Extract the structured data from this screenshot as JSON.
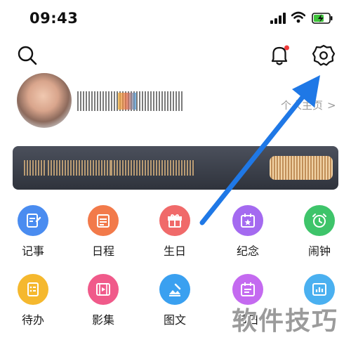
{
  "status_bar": {
    "time": "09:43",
    "icons": [
      "signal-icon",
      "wifi-icon",
      "battery-charging-icon"
    ]
  },
  "top_bar": {
    "icons": [
      "search-icon",
      "bell-icon",
      "gear-icon"
    ],
    "notification_dot_color": "#ef3b3b"
  },
  "profile": {
    "homepage_link": "个人主页",
    "chevron": ">"
  },
  "grid": {
    "items": [
      {
        "label": "记事",
        "icon": "note-icon",
        "color": "#4a8cf0"
      },
      {
        "label": "日程",
        "icon": "schedule-icon",
        "color": "#f27a4a"
      },
      {
        "label": "生日",
        "icon": "gift-icon",
        "color": "#f06a6a"
      },
      {
        "label": "纪念",
        "icon": "calendar-star-icon",
        "color": "#a46af0"
      },
      {
        "label": "闹钟",
        "icon": "alarm-icon",
        "color": "#3ec46a"
      },
      {
        "label": "待办",
        "icon": "todo-icon",
        "color": "#f5b82e"
      },
      {
        "label": "影集",
        "icon": "album-icon",
        "color": "#f05a8a"
      },
      {
        "label": "图文",
        "icon": "image-text-icon",
        "color": "#3aa0f0"
      },
      {
        "label": "节日",
        "icon": "festival-icon",
        "color": "#c46af0"
      },
      {
        "label": "",
        "icon": "chart-icon",
        "color": "#4ab0f0"
      }
    ]
  },
  "overlay": {
    "watermark": "软件技巧",
    "arrow_color": "#1f78e6"
  }
}
